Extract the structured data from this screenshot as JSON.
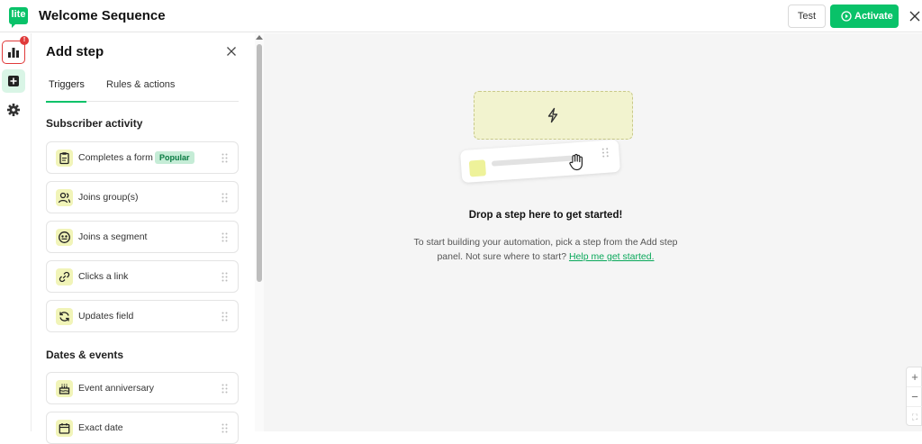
{
  "app": {
    "logo_text": "lite",
    "title": "Welcome Sequence",
    "test_label": "Test",
    "activate_label": "Activate",
    "accent": "#09c269"
  },
  "rail": {
    "chart_badge": "!"
  },
  "panel": {
    "title": "Add step",
    "tabs": [
      {
        "label": "Triggers",
        "active": true
      },
      {
        "label": "Rules & actions",
        "active": false
      }
    ],
    "sections": [
      {
        "title": "Subscriber activity",
        "items": [
          {
            "label": "Completes a form",
            "icon": "clipboard-icon",
            "badge": "Popular"
          },
          {
            "label": "Joins group(s)",
            "icon": "users-icon"
          },
          {
            "label": "Joins a segment",
            "icon": "segment-icon"
          },
          {
            "label": "Clicks a link",
            "icon": "link-icon"
          },
          {
            "label": "Updates field",
            "icon": "refresh-icon"
          }
        ]
      },
      {
        "title": "Dates & events",
        "items": [
          {
            "label": "Event anniversary",
            "icon": "cake-icon"
          },
          {
            "label": "Exact date",
            "icon": "calendar-icon"
          }
        ]
      }
    ]
  },
  "canvas": {
    "drop_title": "Drop a step here to get started!",
    "drop_text": "To start building your automation, pick a step from the Add step panel. Not sure where to start?",
    "help_link": "Help me get started.",
    "zoom_in": "+",
    "zoom_out": "−",
    "zoom_fit": "⛶"
  }
}
